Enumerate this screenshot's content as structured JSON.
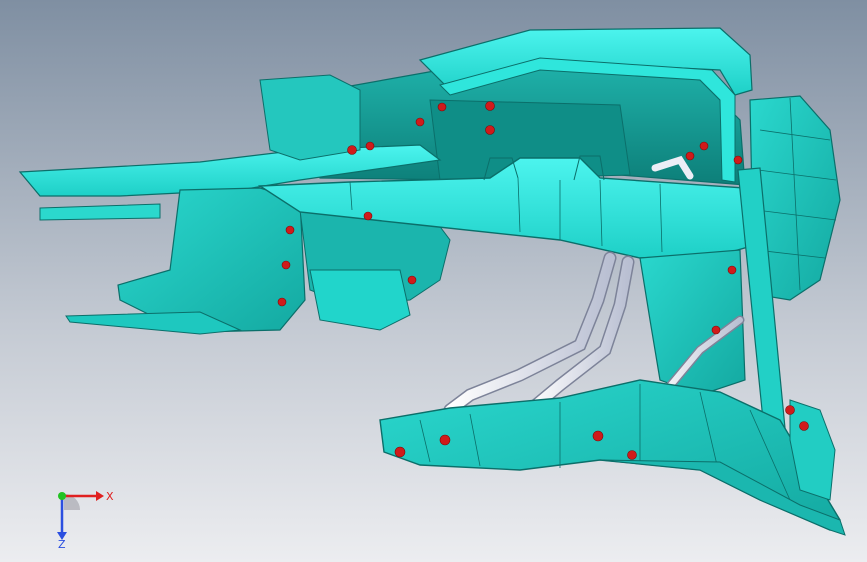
{
  "viewport": {
    "background_top": "#7f8fa2",
    "background_bottom": "#ecedf0"
  },
  "model": {
    "part_color": "#1fd1c6",
    "part_highlight": "#28f5ea",
    "edge_color": "#0b6f6a",
    "pipe_color": "#eceef6",
    "weld_point_color": "#d01b1b"
  },
  "triad": {
    "x_label": "X",
    "z_label": "Z",
    "x_color": "#e02020",
    "y_color": "#22c222",
    "z_color": "#2b4fe0"
  }
}
